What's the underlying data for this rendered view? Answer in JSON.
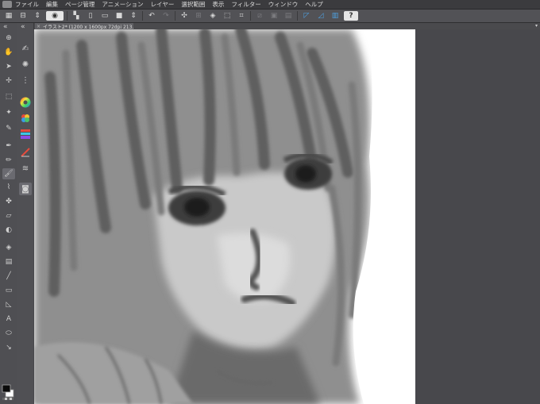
{
  "menu": {
    "items": [
      "ファイル",
      "編集",
      "ページ管理",
      "アニメーション",
      "レイヤー",
      "選択範囲",
      "表示",
      "フィルター",
      "ウィンドウ",
      "ヘルプ"
    ]
  },
  "document": {
    "tab_title": "イラスト2* (1200 x 1600px 72dpi 213.7%)"
  },
  "colors": {
    "accent_blue": "#4ea0e0",
    "menubar_bg": "#3b3b3e",
    "panel_bg": "#4f4f53",
    "canvas_bg": "#ffffff"
  },
  "toolbar_icons": [
    "grid-icon",
    "new-page-icon",
    "open-icon",
    "save-icon",
    "undo-icon",
    "redo-icon",
    "transform-icon",
    "fill-icon",
    "selection-icon",
    "snap-ruler-icon",
    "snap-special-ruler-icon",
    "snap-grid-icon",
    "help-icon"
  ]
}
